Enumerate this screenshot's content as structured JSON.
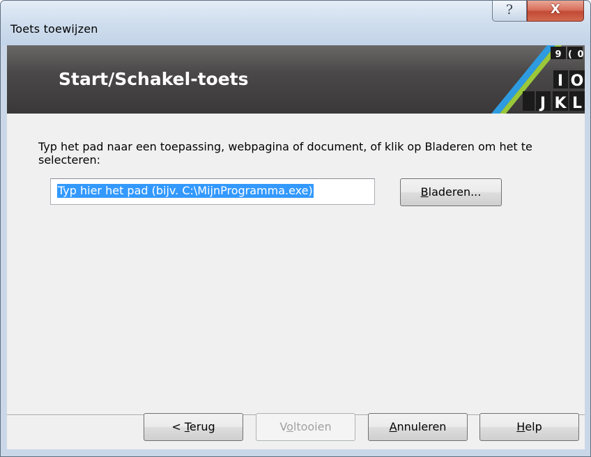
{
  "window": {
    "title": "Toets toewijzen",
    "help_glyph": "?",
    "close_glyph": "X"
  },
  "banner": {
    "title": "Start/Schakel-toets",
    "logo_keys": [
      "9",
      "(",
      "0",
      "I",
      "O",
      "J",
      "K",
      "L"
    ]
  },
  "content": {
    "instruction": "Typ het pad naar een toepassing, webpagina of document, of klik op Bladeren om het te selecteren:",
    "path_input": {
      "value": "Typ hier het pad (bijv. C:\\MijnProgramma.exe)"
    },
    "browse_button": {
      "mnemonic": "B",
      "rest": "laderen..."
    }
  },
  "footer": {
    "back": {
      "prefix": "< ",
      "mnemonic": "T",
      "rest": "erug"
    },
    "finish": {
      "prefix": "V",
      "mnemonic": "o",
      "rest": "ltooien",
      "enabled": false
    },
    "cancel": {
      "mnemonic": "A",
      "rest": "nnuleren"
    },
    "help": {
      "mnemonic": "H",
      "rest": "elp"
    }
  },
  "colors": {
    "banner": "#4a4848",
    "selection": "#3399ff",
    "close_button": "#c24a36"
  }
}
